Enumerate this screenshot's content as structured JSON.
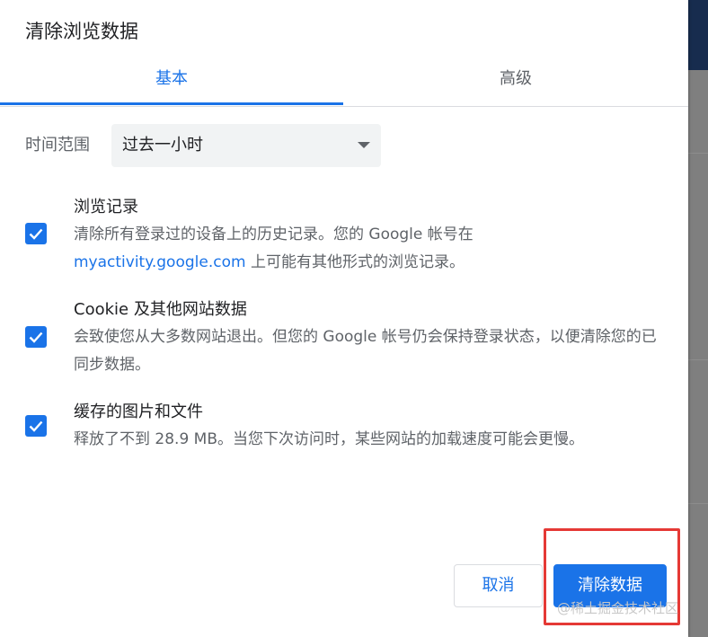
{
  "dialog": {
    "title": "清除浏览数据",
    "tabs": [
      {
        "label": "基本",
        "active": true
      },
      {
        "label": "高级",
        "active": false
      }
    ],
    "time_range": {
      "label": "时间范围",
      "selected": "过去一小时"
    },
    "options": [
      {
        "title": "浏览记录",
        "checked": true,
        "desc_before_link": "清除所有登录过的设备上的历史记录。您的 Google 帐号在",
        "link": "myactivity.google.com",
        "desc_after_link": " 上可能有其他形式的浏览记录。"
      },
      {
        "title": "Cookie 及其他网站数据",
        "checked": true,
        "desc": "会致使您从大多数网站退出。但您的 Google 帐号仍会保持登录状态，以便清除您的已同步数据。"
      },
      {
        "title": "缓存的图片和文件",
        "checked": true,
        "desc": "释放了不到 28.9 MB。当您下次访问时，某些网站的加载速度可能会更慢。"
      }
    ],
    "buttons": {
      "cancel": "取消",
      "clear": "清除数据"
    }
  },
  "watermark": "@稀土掘金技术社区",
  "colors": {
    "accent": "#1a73e8",
    "highlight": "#e53935"
  }
}
